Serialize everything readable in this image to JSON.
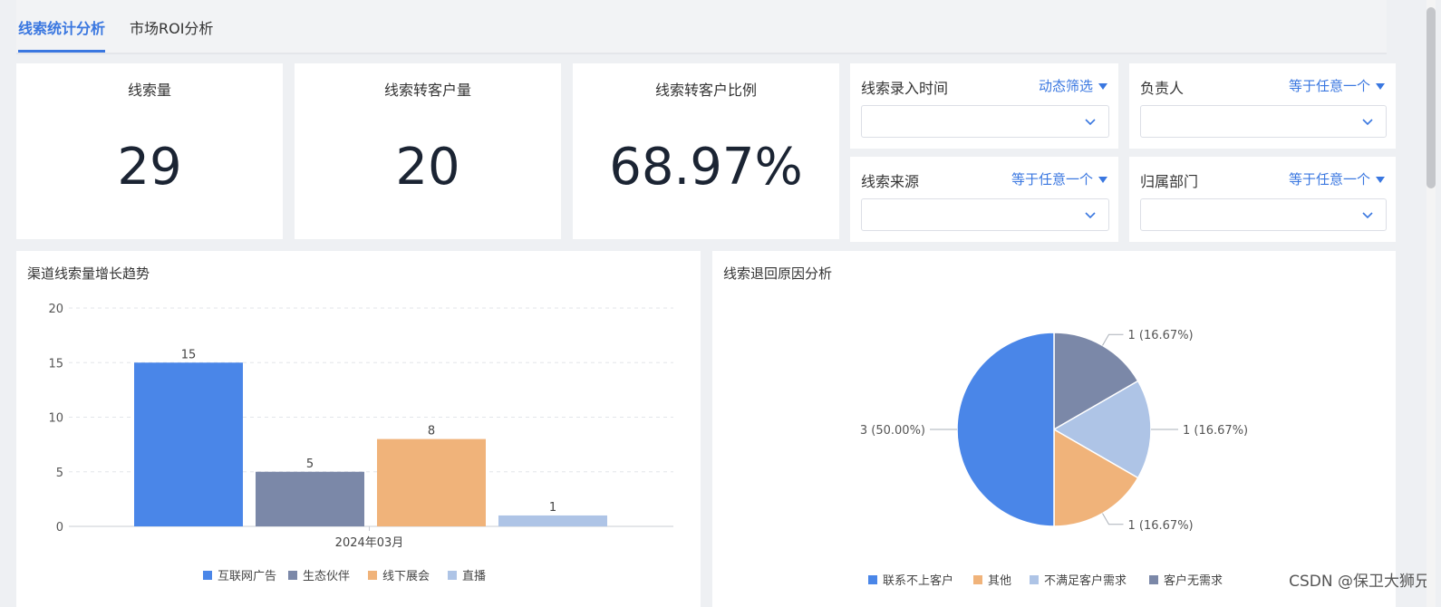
{
  "tabs": [
    {
      "label": "线索统计分析",
      "active": true
    },
    {
      "label": "市场ROI分析",
      "active": false
    }
  ],
  "kpis": [
    {
      "title": "线索量",
      "value": "29"
    },
    {
      "title": "线索转客户量",
      "value": "20"
    },
    {
      "title": "线索转客户比例",
      "value": "68.97%"
    }
  ],
  "filters": [
    {
      "label": "线索录入时间",
      "mode": "动态筛选",
      "value": ""
    },
    {
      "label": "负责人",
      "mode": "等于任意一个",
      "value": ""
    },
    {
      "label": "线索来源",
      "mode": "等于任意一个",
      "value": ""
    },
    {
      "label": "归属部门",
      "mode": "等于任意一个",
      "value": ""
    }
  ],
  "colors": {
    "accent": "#3a77e0",
    "blue": "#4a86e8",
    "slate": "#7b88a8",
    "orange": "#f0b37a",
    "light_blue": "#aec4e6"
  },
  "chart_data": [
    {
      "type": "bar",
      "title": "渠道线索量增长趋势",
      "categories": [
        "2024年03月"
      ],
      "series": [
        {
          "name": "互联网广告",
          "values": [
            15
          ],
          "color": "#4a86e8"
        },
        {
          "name": "生态伙伴",
          "values": [
            5
          ],
          "color": "#7b88a8"
        },
        {
          "name": "线下展会",
          "values": [
            8
          ],
          "color": "#f0b37a"
        },
        {
          "name": "直播",
          "values": [
            1
          ],
          "color": "#aec4e6"
        }
      ],
      "ylim": [
        0,
        20
      ],
      "yticks": [
        0,
        5,
        10,
        15,
        20
      ],
      "grid": true,
      "legend": "bottom"
    },
    {
      "type": "pie",
      "title": "线索退回原因分析",
      "slices": [
        {
          "name": "联系不上客户",
          "value": 3,
          "label": "3 (50.00%)",
          "color": "#4a86e8"
        },
        {
          "name": "其他",
          "value": 1,
          "label": "1 (16.67%)",
          "color": "#f0b37a"
        },
        {
          "name": "不满足客户需求",
          "value": 1,
          "label": "1 (16.67%)",
          "color": "#aec4e6"
        },
        {
          "name": "客户无需求",
          "value": 1,
          "label": "1 (16.67%)",
          "color": "#7b88a8"
        }
      ],
      "legend": "bottom"
    }
  ],
  "watermark": "CSDN @保卫大狮兄"
}
